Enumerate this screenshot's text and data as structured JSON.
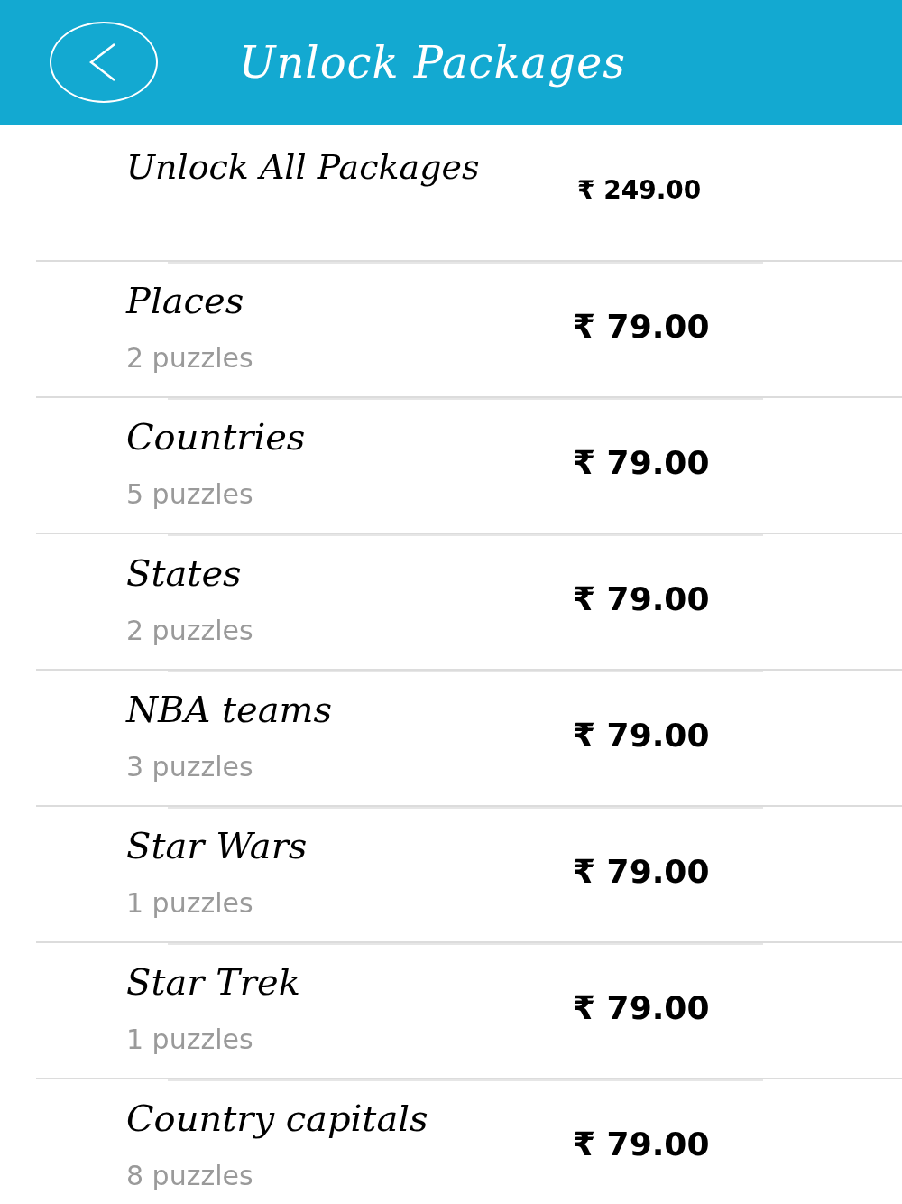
{
  "header": {
    "title": "Unlock Packages"
  },
  "packages": [
    {
      "kind": "bundle",
      "name": "Unlock All Packages",
      "price": "₹ 249.00"
    },
    {
      "kind": "single",
      "name": "Places",
      "puzzles": "2 puzzles",
      "price": "₹ 79.00"
    },
    {
      "kind": "single",
      "name": "Countries",
      "puzzles": "5 puzzles",
      "price": "₹ 79.00"
    },
    {
      "kind": "single",
      "name": "States",
      "puzzles": "2 puzzles",
      "price": "₹ 79.00"
    },
    {
      "kind": "single",
      "name": "NBA teams",
      "puzzles": "3 puzzles",
      "price": "₹ 79.00"
    },
    {
      "kind": "single",
      "name": "Star Wars",
      "puzzles": "1 puzzles",
      "price": "₹ 79.00"
    },
    {
      "kind": "single",
      "name": "Star Trek",
      "puzzles": "1 puzzles",
      "price": "₹ 79.00"
    },
    {
      "kind": "single",
      "name": "Country capitals",
      "puzzles": "8 puzzles",
      "price": "₹ 79.00"
    }
  ]
}
